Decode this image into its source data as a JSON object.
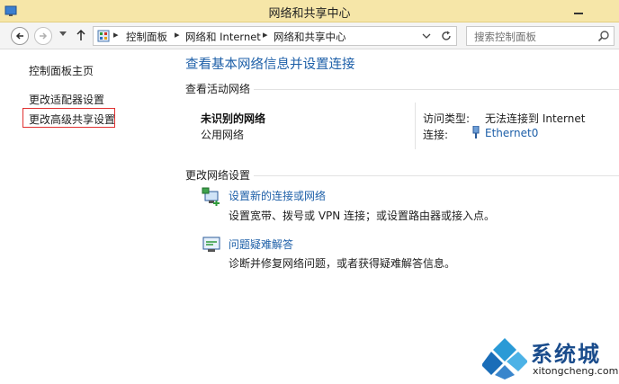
{
  "window": {
    "title": "网络和共享中心"
  },
  "navbar": {
    "breadcrumbs": [
      "控制面板",
      "网络和 Internet",
      "网络和共享中心"
    ],
    "search_placeholder": "搜索控制面板"
  },
  "left_pane": {
    "home": "控制面板主页",
    "adapter": "更改适配器设置",
    "advanced_sharing": "更改高级共享设置"
  },
  "main": {
    "title": "查看基本网络信息并设置连接",
    "active_section": "查看活动网络",
    "network_name": "未识别的网络",
    "network_type": "公用网络",
    "access_label": "访问类型:",
    "access_value": "无法连接到 Internet",
    "connection_label": "连接:",
    "connection_value": "Ethernet0",
    "change_section": "更改网络设置",
    "task1_link": "设置新的连接或网络",
    "task1_desc": "设置宽带、拨号或 VPN 连接；或设置路由器或接入点。",
    "task2_link": "问题疑难解答",
    "task2_desc": "诊断并修复网络问题，或者获得疑难解答信息。"
  },
  "watermark": {
    "brand": "系统城",
    "url": "xitongcheng.com"
  },
  "colors": {
    "link": "#1d5fa8",
    "titlebar": "#f6e6a8",
    "highlight": "#e03030"
  }
}
